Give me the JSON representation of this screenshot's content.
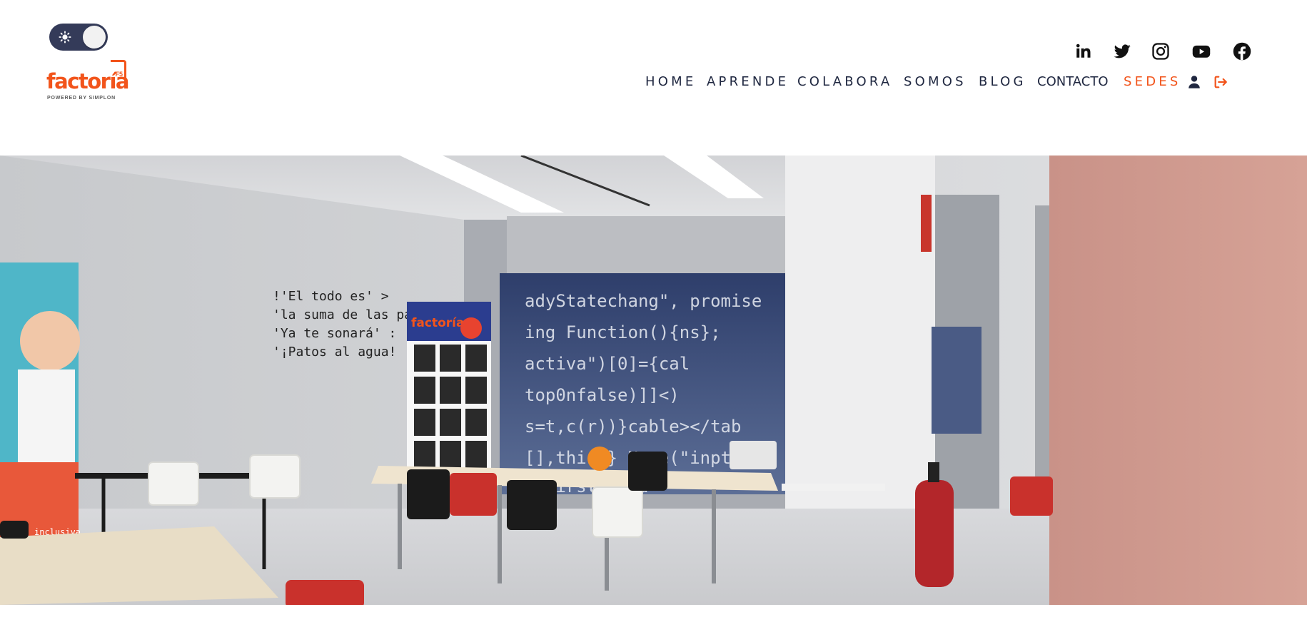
{
  "header": {
    "theme_toggle": {
      "icon": "sun-icon",
      "state": "light"
    },
    "logo": {
      "wordmark": "factoría",
      "badge": "F5",
      "tagline": "POWERED BY SIMPLON"
    },
    "social_links": [
      {
        "name": "linkedin",
        "icon": "linkedin-icon"
      },
      {
        "name": "twitter",
        "icon": "twitter-icon"
      },
      {
        "name": "instagram",
        "icon": "instagram-icon"
      },
      {
        "name": "youtube",
        "icon": "youtube-icon"
      },
      {
        "name": "facebook",
        "icon": "facebook-icon"
      }
    ],
    "nav": {
      "home": "HOME",
      "aprende": "APRENDE",
      "colabora": "COLABORA",
      "somos": "SOMOS",
      "blog": "BLOG",
      "contacto": "CONTACTO",
      "sedes": "SEDES",
      "user_icon": "user-icon",
      "logout_icon": "sign-out-icon"
    }
  },
  "hero": {
    "wall_text": [
      "!'El todo es' >",
      "'la suma de las partes'",
      "'Ya te sonará' :",
      "'¡Patos al agua!"
    ],
    "banner_brand": "factoría",
    "left_banner_text": "inclusiva"
  },
  "colors": {
    "brand_orange": "#f2541b",
    "nav_text": "#1f2740",
    "toggle_bg": "#343b59"
  }
}
